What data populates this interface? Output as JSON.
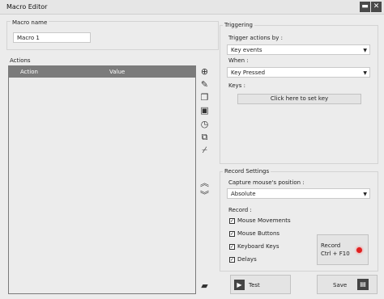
{
  "window": {
    "title": "Macro Editor"
  },
  "macro_name": {
    "label": "Macro name",
    "value": "Macro 1"
  },
  "actions": {
    "label": "Actions",
    "col_action": "Action",
    "col_value": "Value"
  },
  "triggering": {
    "label": "Triggering",
    "trigger_by_label": "Trigger actions by :",
    "trigger_by_value": "Key events",
    "when_label": "When :",
    "when_value": "Key Pressed",
    "keys_label": "Keys :",
    "set_key_button": "Click here to set key"
  },
  "record_settings": {
    "label": "Record Settings",
    "capture_label": "Capture mouse's position :",
    "capture_value": "Absolute",
    "record_label": "Record :",
    "options": [
      {
        "label": "Mouse Movements",
        "checked": true
      },
      {
        "label": "Mouse Buttons",
        "checked": true
      },
      {
        "label": "Keyboard Keys",
        "checked": true
      },
      {
        "label": "Delays",
        "checked": true
      }
    ],
    "record_button_line1": "Record",
    "record_button_line2": "Ctrl + F10"
  },
  "buttons": {
    "test": "Test",
    "save": "Save"
  },
  "icons": {
    "add": "add-icon",
    "edit": "edit-icon",
    "copy": "copy-icon",
    "delete": "delete-icon",
    "delay": "timer-icon",
    "duplicate": "duplicate-icon",
    "clear": "broom-icon",
    "move_up": "chevron-double-up-icon",
    "move_down": "chevron-double-down-icon",
    "folder": "folder-icon",
    "minimize": "minimize-icon",
    "close": "close-icon"
  },
  "colors": {
    "record_dot": "#e02020",
    "table_header": "#7b7b7b"
  }
}
